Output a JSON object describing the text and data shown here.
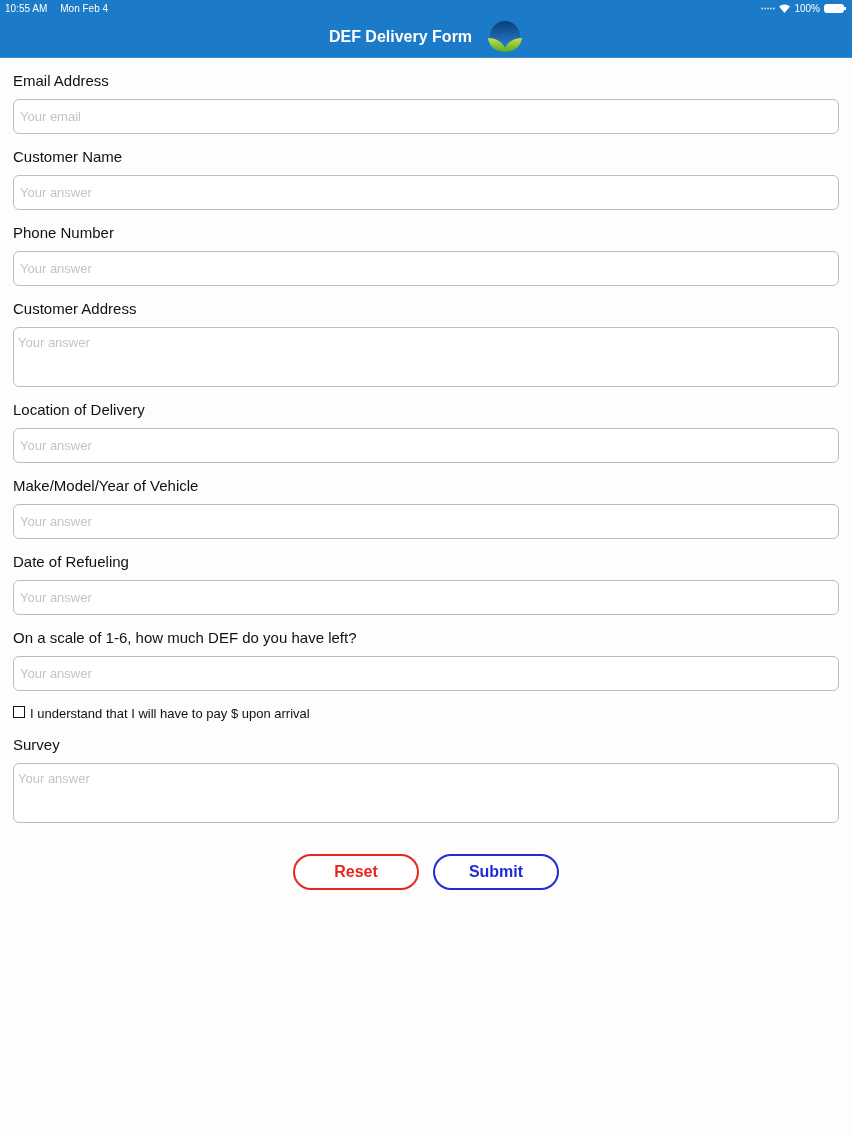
{
  "status_bar": {
    "time": "10:55 AM",
    "date": "Mon Feb 4",
    "battery": "100%"
  },
  "nav_bar": {
    "title": "DEF Delivery Form"
  },
  "form_items": [
    {
      "kind": "text",
      "label": "Email Address",
      "placeholder": "Your email"
    },
    {
      "kind": "text",
      "label": "Customer Name",
      "placeholder": "Your answer"
    },
    {
      "kind": "text",
      "label": "Phone Number",
      "placeholder": "Your answer"
    },
    {
      "kind": "textarea",
      "label": "Customer Address",
      "placeholder": "Your answer"
    },
    {
      "kind": "text",
      "label": "Location of Delivery",
      "placeholder": "Your answer"
    },
    {
      "kind": "text",
      "label": "Make/Model/Year of Vehicle",
      "placeholder": "Your answer"
    },
    {
      "kind": "text",
      "label": "Date of Refueling",
      "placeholder": "Your answer"
    },
    {
      "kind": "text",
      "label": "On a scale of 1-6, how much DEF do you have left?",
      "placeholder": "Your answer"
    },
    {
      "kind": "checkbox",
      "label": "I understand that I will have to pay $ upon arrival",
      "checked": false
    },
    {
      "kind": "textarea",
      "label": "Survey",
      "placeholder": "Your answer"
    }
  ],
  "buttons": [
    {
      "label": "Reset",
      "color": "#e8251e"
    },
    {
      "label": "Submit",
      "color": "#1f2bd6"
    }
  ]
}
